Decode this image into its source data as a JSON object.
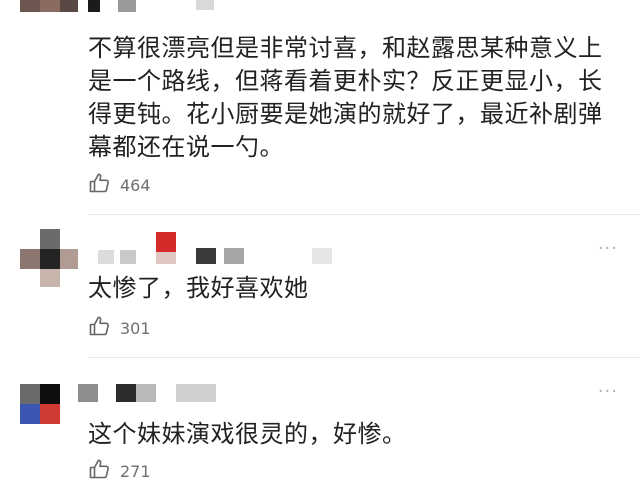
{
  "comments": [
    {
      "text": "不算很漂亮但是非常讨喜，和赵露思某种意义上是一个路线，但蒋看着更朴实？反正更显小，长得更钝。花小厨要是她演的就好了，最近补剧弹幕都还在说一勺。",
      "likes": "464",
      "more": "···"
    },
    {
      "text": "太惨了，我好喜欢她",
      "likes": "301",
      "more": "···"
    },
    {
      "text": "这个妹妹演戏很灵的，好惨。",
      "likes": "271",
      "more": "···"
    }
  ],
  "icons": {
    "like": "thumbs-up-icon",
    "more": "more-options-icon"
  },
  "colors": {
    "text": "#222222",
    "meta": "#6f6f6f",
    "divider": "#e6e6e6",
    "icon": "#666666"
  }
}
